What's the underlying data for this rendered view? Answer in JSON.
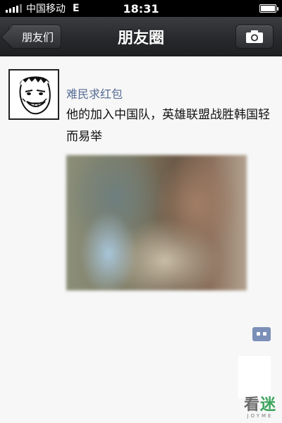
{
  "status_bar": {
    "carrier": "中国移动",
    "network": "E",
    "time": "18:31",
    "battery_level": 1.0
  },
  "nav": {
    "back_label": "朋友们",
    "title": "朋友圈",
    "camera_icon": "camera-icon"
  },
  "post": {
    "username": "难民求红包",
    "text": "他的加入中国队，英雄联盟战胜韩国轻而易举",
    "comment_icon": "comment-icon"
  },
  "watermark": {
    "main_a": "看",
    "main_b": "迷",
    "sub": "JOYME"
  },
  "colors": {
    "username": "#576b95",
    "navbar": "#2a2c2f",
    "comment_icon": "#7b8fb8"
  }
}
